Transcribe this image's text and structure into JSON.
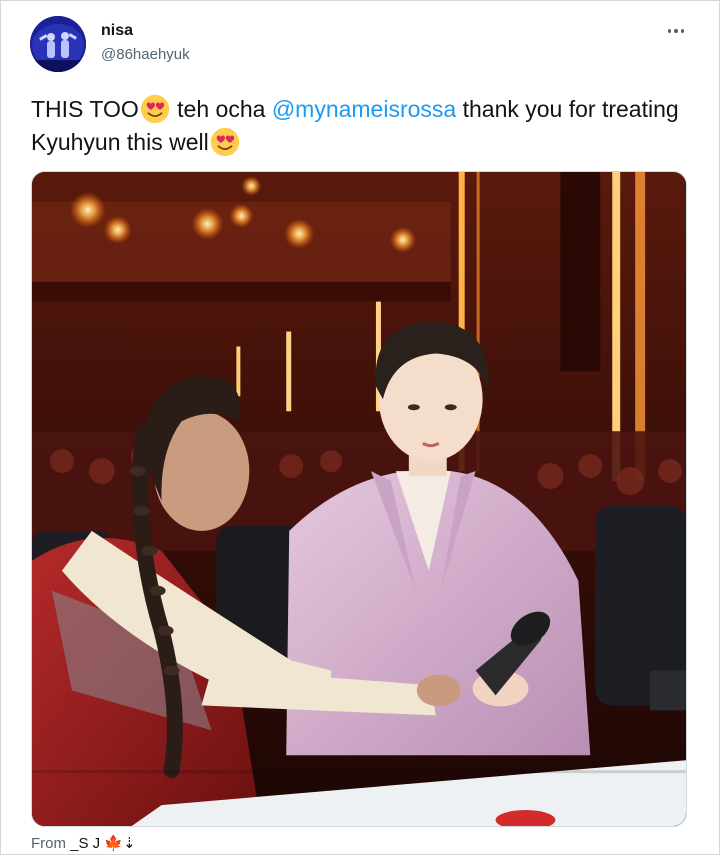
{
  "user": {
    "display_name": "nisa",
    "handle": "@86haehyuk"
  },
  "more_icon": "more-horizontal-icon",
  "tweet": {
    "text_part1": "THIS TOO",
    "text_part2": " teh ocha ",
    "mention": "@mynameisrossa",
    "text_part3": " thank you for treating Kyuhyun this well",
    "emoji": "smiling-face-with-heart-eyes-emoji"
  },
  "media": {
    "type": "photo",
    "alt": ""
  },
  "footer": {
    "from_label": "From",
    "source": "_S J 🍁⇣"
  },
  "colors": {
    "link": "#1d9bf0",
    "secondary_text": "#536471",
    "primary_text": "#0f1419",
    "border": "#cfd9de"
  }
}
